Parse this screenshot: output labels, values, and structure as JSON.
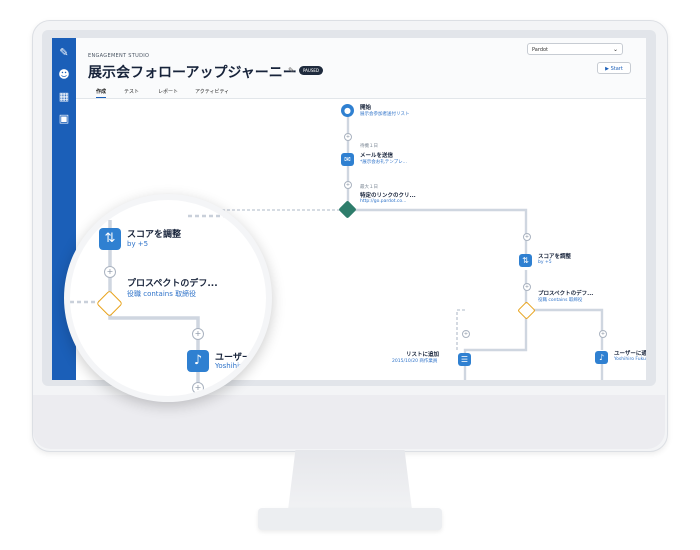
{
  "app": {
    "eyebrow": "ENGAGEMENT STUDIO",
    "title": "展示会フォローアップジャーニー",
    "status_badge": "PAUSED",
    "account_select": "Pardot",
    "start_label": "Start"
  },
  "tabs": [
    {
      "label": "作成"
    },
    {
      "label": "テスト"
    },
    {
      "label": "レポート"
    },
    {
      "label": "アクティビティ"
    }
  ],
  "flow": {
    "start": {
      "label": "開始",
      "sub": "展示会参加者送付リスト"
    },
    "wait1": {
      "meta": "待機１日"
    },
    "email": {
      "label": "メールを送信",
      "sub": "*展示会お礼テンプレ..."
    },
    "wait2": {
      "meta": "最大１日"
    },
    "trigger": {
      "label": "特定のリンクのクリ...",
      "sub": "http://go.pardot.co..."
    },
    "score_right": {
      "label": "スコアを調整",
      "sub": "by +5"
    },
    "prospect_right": {
      "label": "プロスペクトのデフ...",
      "sub": "役職 contains 取締役"
    },
    "list_add": {
      "label": "リストに追加",
      "sub": "2015/10/20 商作業員"
    },
    "notify_right": {
      "label": "ユーザーに通",
      "sub": "Yoshihiro Fuku"
    }
  },
  "magnified": {
    "score": {
      "label": "スコアを調整",
      "sub": "by +5"
    },
    "prospect": {
      "label": "プロスペクトのデフ...",
      "sub": "役職 contains 取締役"
    },
    "notify": {
      "label": "ユーザーに",
      "sub": "Yoshihiro F"
    }
  },
  "colors": {
    "nav": "#1b5fb8",
    "node": "#2f80d1",
    "rule": "#2e7d6b",
    "connector": "#cfd6e0"
  }
}
